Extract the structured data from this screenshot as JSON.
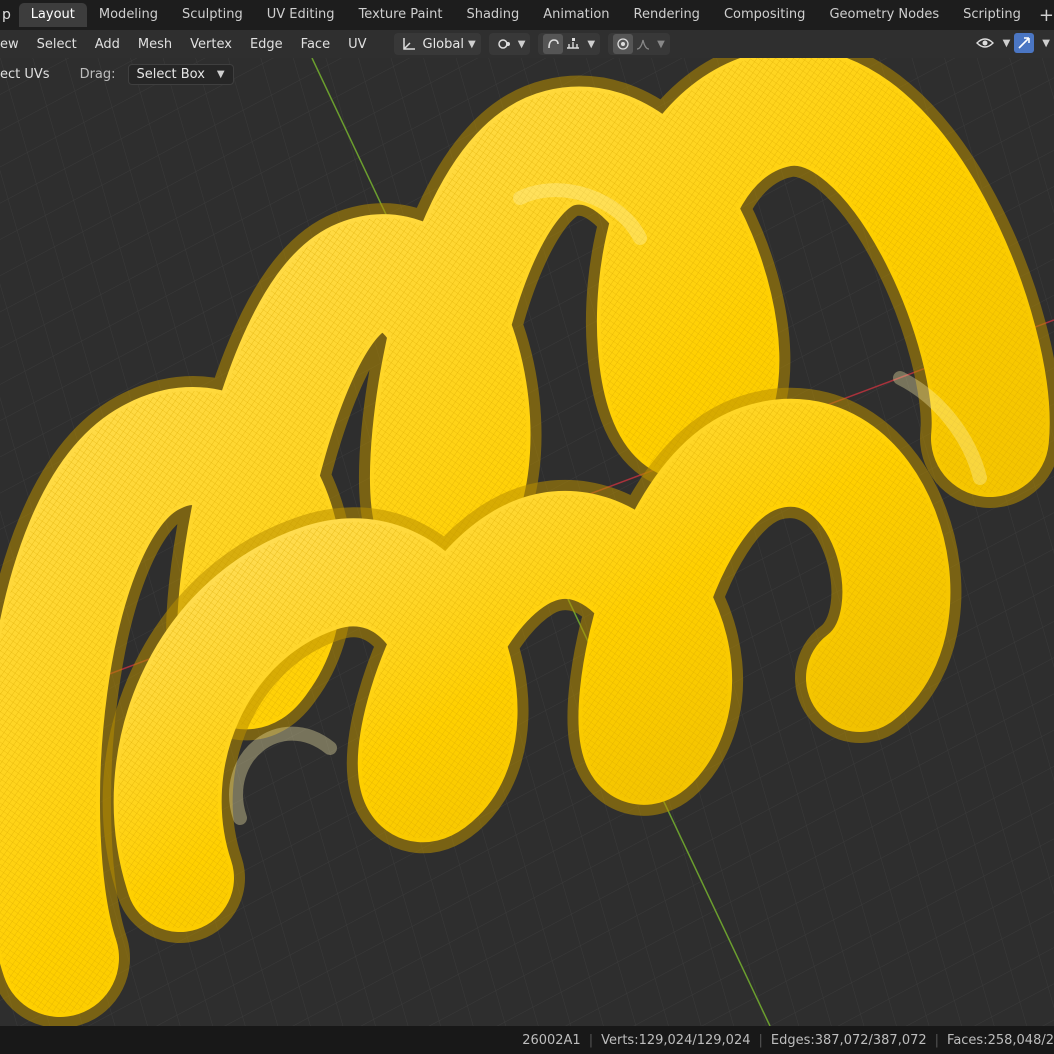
{
  "workspace_tabs": [
    "Layout",
    "Modeling",
    "Sculpting",
    "UV Editing",
    "Texture Paint",
    "Shading",
    "Animation",
    "Rendering",
    "Compositing",
    "Geometry Nodes",
    "Scripting"
  ],
  "app_stub": "p",
  "header": {
    "menus": [
      "ew",
      "Select",
      "Add",
      "Mesh",
      "Vertex",
      "Edge",
      "Face",
      "UV"
    ],
    "transform_orientation": "Global"
  },
  "tool_settings": {
    "label": "ect UVs",
    "drag_label": "Drag:",
    "drag_value": "Select Box"
  },
  "status": {
    "scene_id": "26002A1",
    "verts": "Verts:129,024/129,024",
    "edges": "Edges:387,072/387,072",
    "faces": "Faces:258,048/2"
  },
  "colors": {
    "mesh_selected": "#ffd000",
    "x_axis": "#a8323b",
    "y_axis": "#6b9e2e",
    "accent": "#4b76c3"
  }
}
